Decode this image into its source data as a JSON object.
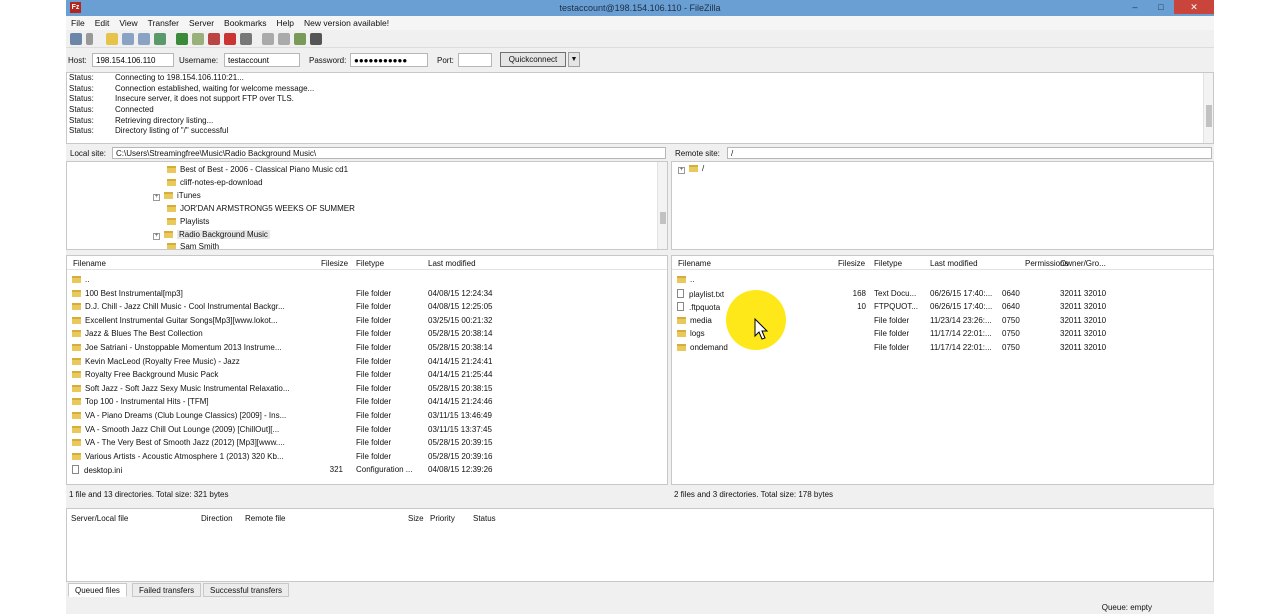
{
  "window": {
    "title": "testaccount@198.154.106.110 - FileZilla",
    "app_icon": "Fz",
    "minimize": "–",
    "maximize": "□",
    "close": "✕"
  },
  "menu": [
    "File",
    "Edit",
    "View",
    "Transfer",
    "Server",
    "Bookmarks",
    "Help",
    "New version available!"
  ],
  "quickconnect": {
    "host_label": "Host:",
    "host": "198.154.106.110",
    "user_label": "Username:",
    "user": "testaccount",
    "pass_label": "Password:",
    "pass": "●●●●●●●●●●●",
    "port_label": "Port:",
    "port": "",
    "button": "Quickconnect"
  },
  "log": [
    {
      "k": "Status:",
      "v": "Connecting to 198.154.106.110:21..."
    },
    {
      "k": "Status:",
      "v": "Connection established, waiting for welcome message..."
    },
    {
      "k": "Status:",
      "v": "Insecure server, it does not support FTP over TLS."
    },
    {
      "k": "Status:",
      "v": "Connected"
    },
    {
      "k": "Status:",
      "v": "Retrieving directory listing..."
    },
    {
      "k": "Status:",
      "v": "Directory listing of \"/\" successful"
    }
  ],
  "local": {
    "site_label": "Local site:",
    "site_path": "C:\\Users\\Streamingfree\\Music\\Radio Background Music\\",
    "tree": [
      {
        "name": "Best of Best - 2006 - Classical Piano Music cd1",
        "plus": false
      },
      {
        "name": "cliff-notes-ep-download",
        "plus": false
      },
      {
        "name": "iTunes",
        "plus": true
      },
      {
        "name": "JOR'DAN ARMSTRONG5 WEEKS OF SUMMER",
        "plus": false
      },
      {
        "name": "Playlists",
        "plus": false
      },
      {
        "name": "Radio Background Music",
        "plus": true,
        "selected": true
      },
      {
        "name": "Sam Smith",
        "plus": false
      }
    ],
    "headers": {
      "name": "Filename",
      "size": "Filesize",
      "type": "Filetype",
      "modified": "Last modified"
    },
    "files": [
      {
        "name": "..",
        "size": "",
        "type": "",
        "modified": "",
        "kind": "folder"
      },
      {
        "name": "100 Best Instrumental[mp3]",
        "size": "",
        "type": "File folder",
        "modified": "04/08/15 12:24:34",
        "kind": "folder"
      },
      {
        "name": "D.J. Chill - Jazz Chill Music - Cool Instrumental Backgr...",
        "size": "",
        "type": "File folder",
        "modified": "04/08/15 12:25:05",
        "kind": "folder"
      },
      {
        "name": "Excellent Instrumental Guitar Songs[Mp3][www.lokot...",
        "size": "",
        "type": "File folder",
        "modified": "03/25/15 00:21:32",
        "kind": "folder"
      },
      {
        "name": "Jazz & Blues The Best Collection",
        "size": "",
        "type": "File folder",
        "modified": "05/28/15 20:38:14",
        "kind": "folder"
      },
      {
        "name": "Joe Satriani - Unstoppable Momentum 2013 Instrume...",
        "size": "",
        "type": "File folder",
        "modified": "05/28/15 20:38:14",
        "kind": "folder"
      },
      {
        "name": "Kevin MacLeod (Royalty Free Music) - Jazz",
        "size": "",
        "type": "File folder",
        "modified": "04/14/15 21:24:41",
        "kind": "folder"
      },
      {
        "name": "Royalty Free Background Music Pack",
        "size": "",
        "type": "File folder",
        "modified": "04/14/15 21:25:44",
        "kind": "folder"
      },
      {
        "name": "Soft Jazz - Soft Jazz Sexy Music Instrumental Relaxatio...",
        "size": "",
        "type": "File folder",
        "modified": "05/28/15 20:38:15",
        "kind": "folder"
      },
      {
        "name": "Top 100 - Instrumental Hits - [TFM]",
        "size": "",
        "type": "File folder",
        "modified": "04/14/15 21:24:46",
        "kind": "folder"
      },
      {
        "name": "VA - Piano Dreams (Club Lounge Classics) [2009] - Ins...",
        "size": "",
        "type": "File folder",
        "modified": "03/11/15 13:46:49",
        "kind": "folder"
      },
      {
        "name": "VA - Smooth Jazz Chill Out Lounge (2009) [ChillOut][...",
        "size": "",
        "type": "File folder",
        "modified": "03/11/15 13:37:45",
        "kind": "folder"
      },
      {
        "name": "VA - The Very Best of Smooth Jazz (2012) [Mp3][www....",
        "size": "",
        "type": "File folder",
        "modified": "05/28/15 20:39:15",
        "kind": "folder"
      },
      {
        "name": "Various Artists - Acoustic Atmosphere 1 (2013) 320 Kb...",
        "size": "",
        "type": "File folder",
        "modified": "05/28/15 20:39:16",
        "kind": "folder"
      },
      {
        "name": "desktop.ini",
        "size": "321",
        "type": "Configuration ...",
        "modified": "04/08/15 12:39:26",
        "kind": "file"
      }
    ],
    "status": "1 file and 13 directories. Total size: 321 bytes"
  },
  "remote": {
    "site_label": "Remote site:",
    "site_path": "/",
    "tree_root": "/",
    "headers": {
      "name": "Filename",
      "size": "Filesize",
      "type": "Filetype",
      "modified": "Last modified",
      "perms": "Permissions",
      "owner": "Owner/Gro..."
    },
    "files": [
      {
        "name": "..",
        "size": "",
        "type": "",
        "modified": "",
        "perms": "",
        "owner": "",
        "kind": "folder"
      },
      {
        "name": "playlist.txt",
        "size": "168",
        "type": "Text Docu...",
        "modified": "06/26/15 17:40:...",
        "perms": "0640",
        "owner": "32011 32010",
        "kind": "file"
      },
      {
        "name": ".ftpquota",
        "size": "10",
        "type": "FTPQUOT...",
        "modified": "06/26/15 17:40:...",
        "perms": "0640",
        "owner": "32011 32010",
        "kind": "file"
      },
      {
        "name": "media",
        "size": "",
        "type": "File folder",
        "modified": "11/23/14 23:26:...",
        "perms": "0750",
        "owner": "32011 32010",
        "kind": "folder"
      },
      {
        "name": "logs",
        "size": "",
        "type": "File folder",
        "modified": "11/17/14 22:01:...",
        "perms": "0750",
        "owner": "32011 32010",
        "kind": "folder"
      },
      {
        "name": "ondemand",
        "size": "",
        "type": "File folder",
        "modified": "11/17/14 22:01:...",
        "perms": "0750",
        "owner": "32011 32010",
        "kind": "folder"
      }
    ],
    "status": "2 files and 3 directories. Total size: 178 bytes"
  },
  "queue": {
    "headers": {
      "server": "Server/Local file",
      "direction": "Direction",
      "remote": "Remote file",
      "size": "Size",
      "priority": "Priority",
      "status": "Status"
    },
    "tabs": [
      "Queued files",
      "Failed transfers",
      "Successful transfers"
    ],
    "status": "Queue: empty"
  },
  "colors": {
    "titlebar": "#6a9fd4",
    "folder": "#e9c95b",
    "highlight": "#ffe600",
    "close": "#c9443a"
  }
}
